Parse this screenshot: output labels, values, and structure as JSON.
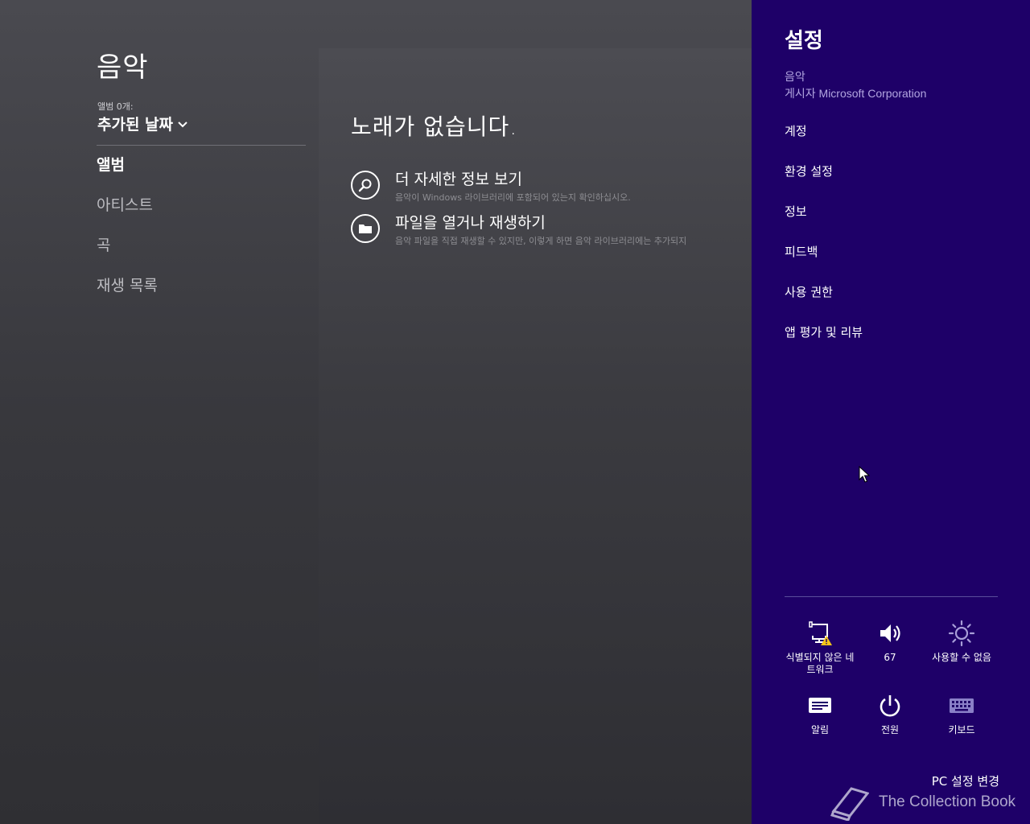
{
  "app": {
    "title": "음악",
    "album_count_label": "앨범 0개:",
    "sort_label": "추가된 날짜",
    "nav": [
      {
        "label": "앨범",
        "active": true
      },
      {
        "label": "아티스트",
        "active": false
      },
      {
        "label": "곡",
        "active": false
      },
      {
        "label": "재생 목록",
        "active": false
      }
    ]
  },
  "main": {
    "empty_title": "노래가 없습니다.",
    "actions": [
      {
        "icon": "search-icon",
        "title": "더 자세한 정보 보기",
        "subtitle": "음악이 Windows 라이브러리에 포함되어 있는지 확인하십시오."
      },
      {
        "icon": "folder-icon",
        "title": "파일을 열거나 재생하기",
        "subtitle": "음악 파일을 직접 재생할 수 있지만, 이렇게 하면 음악 라이브러리에는 추가되지"
      }
    ]
  },
  "charm": {
    "title": "설정",
    "app_name": "음악",
    "publisher": "게시자 Microsoft Corporation",
    "menu": [
      "계정",
      "환경 설정",
      "정보",
      "피드백",
      "사용 권한",
      "앱 평가 및 리뷰"
    ],
    "tiles": [
      {
        "icon": "network-warning-icon",
        "label": "식별되지 않은 네트워크"
      },
      {
        "icon": "volume-icon",
        "label": "67"
      },
      {
        "icon": "brightness-icon",
        "label": "사용할 수 없음"
      },
      {
        "icon": "notifications-icon",
        "label": "알림"
      },
      {
        "icon": "power-icon",
        "label": "전원"
      },
      {
        "icon": "keyboard-icon",
        "label": "키보드"
      }
    ],
    "pc_settings": "PC 설정 변경",
    "watermark": "The Collection Book"
  },
  "colors": {
    "charm_bg": "#1e0068",
    "charm_secondary_text": "#b2a6e0",
    "warning": "#f5c518"
  }
}
